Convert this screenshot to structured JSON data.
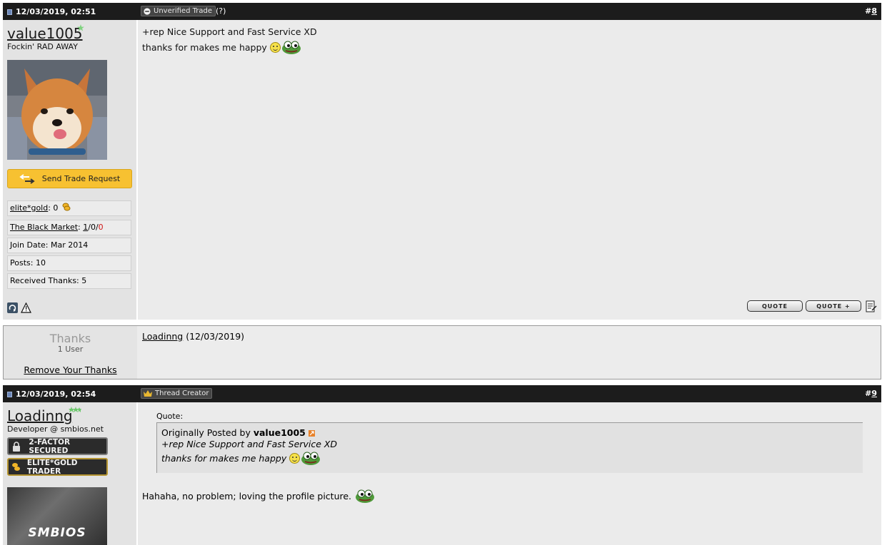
{
  "post8": {
    "date": "12/03/2019, 02:51",
    "tag_label": "Unverified Trade",
    "help_mark": "(?)",
    "post_prefix": "#",
    "post_number": "8",
    "username": "value1005",
    "user_title": "Fockin' RAD AWAY",
    "trade_button": "Send Trade Request",
    "gold_label": "elite*gold",
    "gold_value": ": 0",
    "market_label": "The Black Market",
    "market_sep": ": ",
    "market_pos": "1",
    "market_neutral": "/0/",
    "market_neg": "0",
    "join_date": "Join Date: Mar 2014",
    "posts": "Posts: 10",
    "thanks_received": "Received Thanks: 5",
    "message_line1": "+rep Nice Support and Fast Service XD",
    "message_line2": "thanks for makes me happy",
    "quote_btn": "QUOTE",
    "quote_plus_btn": "QUOTE +"
  },
  "thanks_box": {
    "title": "Thanks",
    "count": "1 User",
    "remove_link": "Remove Your Thanks",
    "user_link": "Loadinng",
    "user_date": " (12/03/2019)"
  },
  "post9": {
    "date": "12/03/2019, 02:54",
    "tag_label": "Thread Creator",
    "post_prefix": "#",
    "post_number": "9",
    "username": "Loadinng",
    "user_title": "Developer @ smbios.net",
    "badge1": "2-FACTOR SECURED",
    "badge2": "ELITE*GOLD TRADER",
    "avatar_text": "SMBIOS",
    "quote_label": "Quote:",
    "quote_orig_prefix": "Originally Posted by ",
    "quote_author": "value1005",
    "quote_line1": "+rep Nice Support and Fast Service XD",
    "quote_line2": "thanks for makes me happy",
    "reply": "Hahaha, no problem; loving the profile picture."
  },
  "colors": {
    "header_bar": "#1c1c1c",
    "sidebar_bg": "#e3e3e3",
    "content_bg": "#ebebeb",
    "trade_button": "#f7c131",
    "positive": "#2a9a2a",
    "negative": "#d01818"
  }
}
